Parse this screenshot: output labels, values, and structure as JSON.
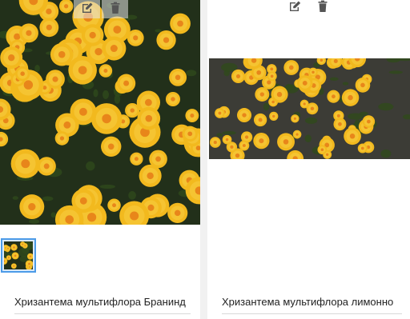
{
  "products": [
    {
      "title": "Хризантема мультифлора Бранинд",
      "image_alt": "yellow chrysanthemum photo",
      "thumbnail_alt": "yellow chrysanthemum thumbnail",
      "actions": {
        "edit_icon": "edit-icon",
        "delete_icon": "trash-icon"
      }
    },
    {
      "title": "Хризантема мультифлора лимонно",
      "image_alt": "yellow chrysanthemum photo",
      "thumbnail_alt": "yellow chrysanthemum thumbnail",
      "actions": {
        "edit_icon": "edit-icon",
        "delete_icon": "trash-icon"
      }
    }
  ],
  "colors": {
    "icon": "#555555",
    "thumbnail_border": "#4c9be8",
    "flower_gold": "#f2b91e",
    "flower_orange": "#e8861a",
    "foliage": "#2f4a1c"
  }
}
